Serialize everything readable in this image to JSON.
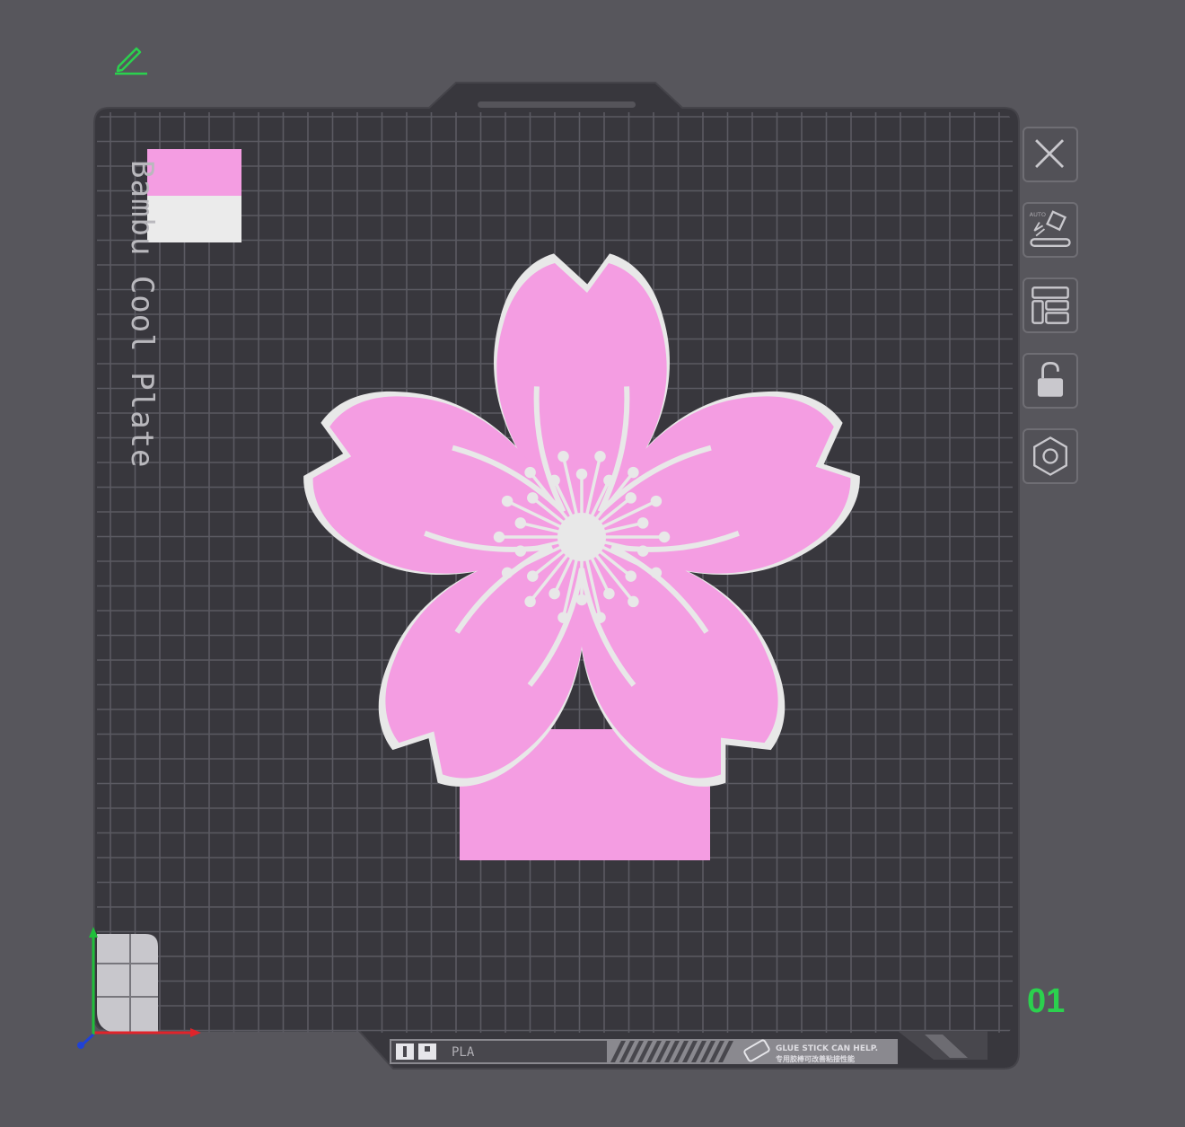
{
  "plate": {
    "name_label": "Bambu Cool Plate",
    "number": "01",
    "filament_type": "PLA",
    "note_en": "GLUE STICK CAN HELP.",
    "note_cn": "专用胶棒可改善粘接性能"
  },
  "colors": {
    "background": "#57565c",
    "plate": "#38373d",
    "grid": "#5b5a62",
    "petal_pink": "#f49de2",
    "outline_white": "#e8e8e8",
    "accent_green": "#2bd14e",
    "axis_x_red": "#e0242b",
    "axis_y_green": "#1fbf3a",
    "axis_z_blue": "#2042d6"
  },
  "swatches": [
    {
      "color": "#f49de2",
      "name": "pink"
    },
    {
      "color": "#ebebeb",
      "name": "white"
    }
  ],
  "toolbar": {
    "buttons": [
      {
        "name": "remove-plate-button",
        "icon": "close-icon"
      },
      {
        "name": "auto-orient-button",
        "icon": "auto-orient-icon",
        "caption": "AUTO"
      },
      {
        "name": "arrange-button",
        "icon": "arrange-icon"
      },
      {
        "name": "lock-plate-button",
        "icon": "unlock-icon"
      },
      {
        "name": "plate-settings-button",
        "icon": "hexagon-nut-icon"
      }
    ]
  }
}
